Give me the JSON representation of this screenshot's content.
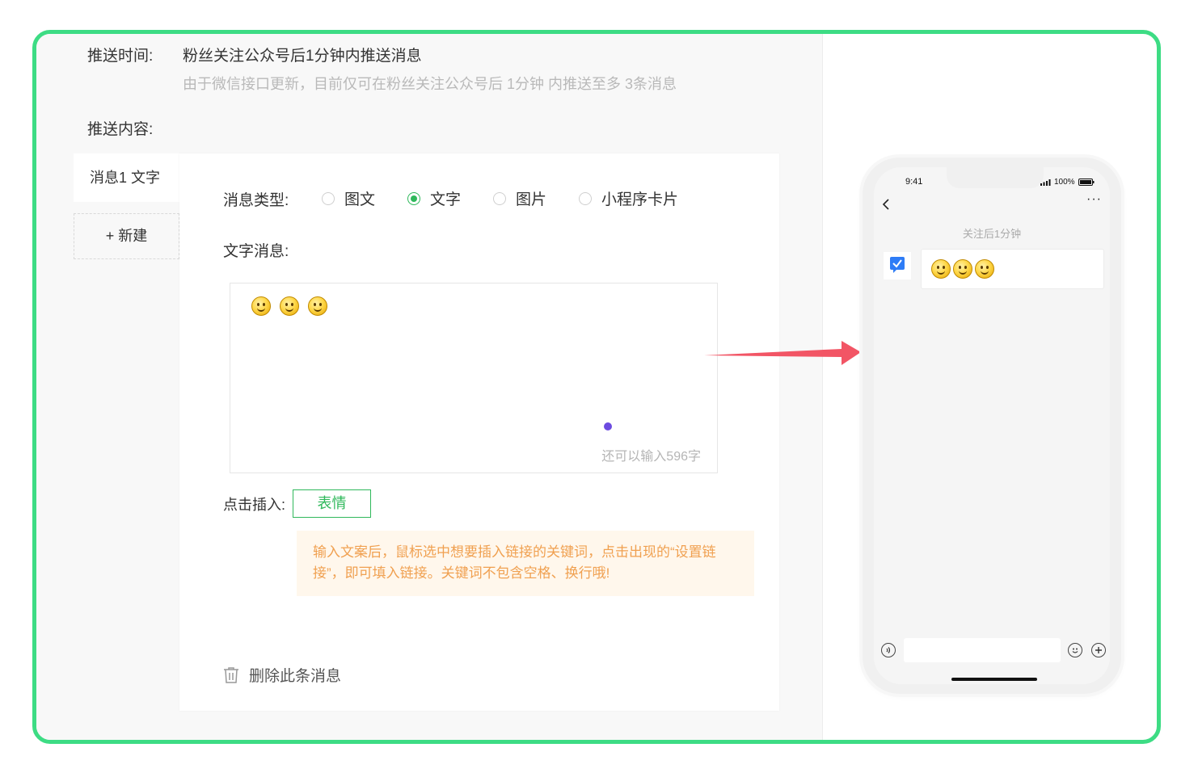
{
  "push_time": {
    "label": "推送时间:",
    "value": "粉丝关注公众号后1分钟内推送消息",
    "hint": "由于微信接口更新，目前仅可在粉丝关注公众号后 1分钟 内推送至多 3条消息"
  },
  "push_content": {
    "label": "推送内容:"
  },
  "messages": {
    "tab_label": "消息1 文字",
    "new_button": "+ 新建"
  },
  "message_type": {
    "label": "消息类型:",
    "options": [
      "图文",
      "文字",
      "图片",
      "小程序卡片"
    ],
    "selected": "文字"
  },
  "text_message": {
    "label": "文字消息:",
    "remaining": "还可以输入596字",
    "emoji_count": 3
  },
  "insert": {
    "label": "点击插入:",
    "emoji_button": "表情"
  },
  "tip": "输入文案后，鼠标选中想要插入链接的关键词，点击出现的“设置链接”，即可填入链接。关键词不包含空格、换行哦!",
  "delete_label": "删除此条消息",
  "phone": {
    "time": "9:41",
    "battery": "100%",
    "chat_note": "关注后1分钟"
  },
  "colors": {
    "frame_border": "#3ddc84",
    "accent_green": "#2fb85b",
    "arrow": "#f25565",
    "tip_text": "#f0a050",
    "tip_bg": "#fff7ec"
  }
}
